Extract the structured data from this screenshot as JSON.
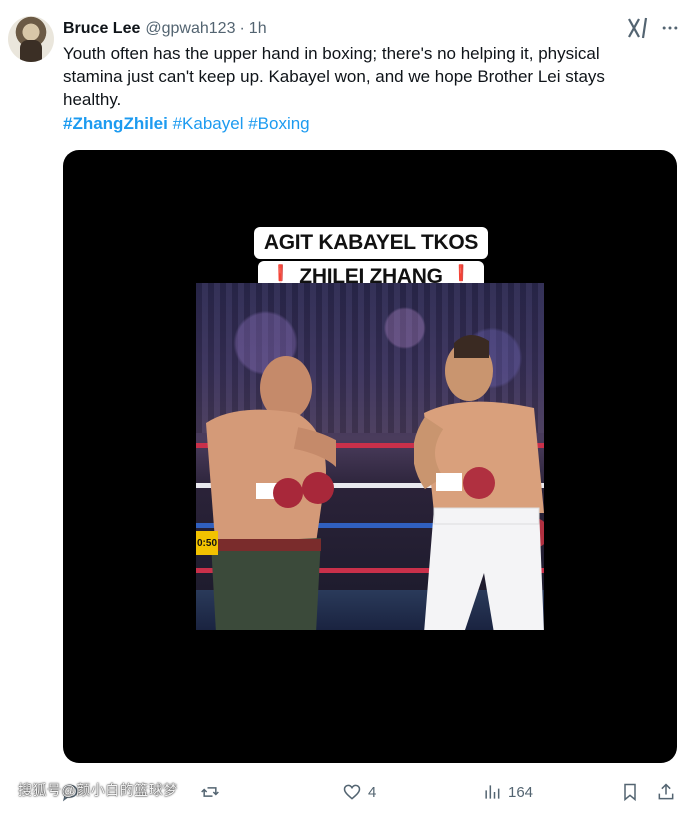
{
  "tweet": {
    "author_name": "Bruce Lee",
    "author_handle": "@gpwah123",
    "separator": "·",
    "time": "1h",
    "text": "Youth often has the upper hand in boxing; there's no helping it, physical stamina just can't keep up. Kabayel won, and we hope Brother Lei stays healthy.",
    "hashtags": [
      "#ZhangZhilei",
      "#Kabayel",
      "#Boxing"
    ]
  },
  "media": {
    "caption_line1": "AGIT KABAYEL TKOS",
    "caption_line2_prefix": "❗",
    "caption_line2_text": " ZHILEI ZHANG ",
    "caption_line2_suffix": "❗",
    "score_badge": "0:50"
  },
  "actions": {
    "reply_count": "",
    "retweet_count": "",
    "like_count": "4",
    "views_count": "164"
  },
  "watermark": "搜狐号@颜小白的篮球梦",
  "colors": {
    "link": "#1d9bf0",
    "secondary": "#536471",
    "text": "#0f1419"
  }
}
